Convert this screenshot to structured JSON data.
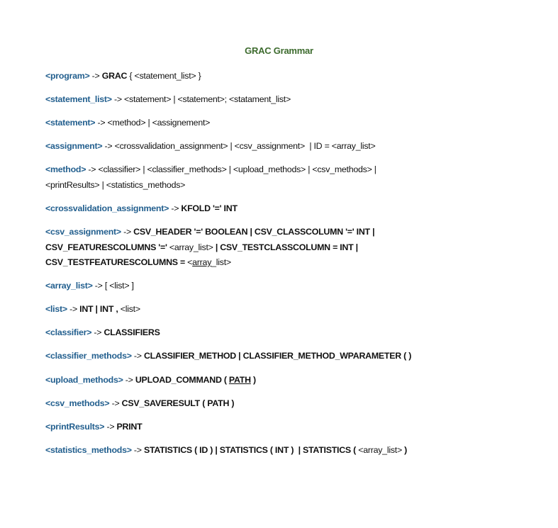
{
  "title": "GRAC Grammar",
  "colors": {
    "title": "#3d6b2e",
    "nonterminal": "#24608f",
    "text": "#111111"
  },
  "rules": [
    {
      "lhs": "<program>",
      "rhs": [
        {
          "t": " -> ",
          "s": "normal"
        },
        {
          "t": "GRAC",
          "s": "bold"
        },
        {
          "t": " { <statement_list> }",
          "s": "normal"
        }
      ]
    },
    {
      "lhs": "<statement_list>",
      "rhs": [
        {
          "t": " -> <statement> | <statement>; <statament_list>",
          "s": "normal"
        }
      ]
    },
    {
      "lhs": "<statement>",
      "rhs": [
        {
          "t": " -> <method> | <assignement>",
          "s": "normal"
        }
      ]
    },
    {
      "lhs": "<assignment>",
      "rhs": [
        {
          "t": " -> <crossvalidation_assignment> | <csv_assignment>  | ID = <array_list>",
          "s": "normal"
        }
      ]
    },
    {
      "lhs": "<method>",
      "rhs": [
        {
          "t": " -> <classifier> | <classifier_methods> | <upload_methods> | <csv_methods> |\n<printResults> | <statistics_methods>",
          "s": "normal"
        }
      ]
    },
    {
      "lhs": "<crossvalidation_assignment>",
      "rhs": [
        {
          "t": " -> ",
          "s": "normal"
        },
        {
          "t": "KFOLD '=' INT",
          "s": "bold"
        }
      ]
    },
    {
      "lhs": "<csv_assignment>",
      "rhs": [
        {
          "t": " -> ",
          "s": "normal"
        },
        {
          "t": "CSV_HEADER '=' BOOLEAN | CSV_CLASSCOLUMN '=' INT |\nCSV_FEATURESCOLUMNS '='",
          "s": "bold"
        },
        {
          "t": " <array_list> ",
          "s": "normal"
        },
        {
          "t": "| CSV_TESTCLASSCOLUMN = INT |\nCSV_TESTFEATURESCOLUMNS = ",
          "s": "bold"
        },
        {
          "t": "<",
          "s": "normal"
        },
        {
          "t": "array",
          "s": "underline"
        },
        {
          "t": "_list>",
          "s": "normal"
        }
      ]
    },
    {
      "lhs": "<array_list>",
      "rhs": [
        {
          "t": " -> [ <list> ]",
          "s": "normal"
        }
      ]
    },
    {
      "lhs": "<list>",
      "rhs": [
        {
          "t": " -> ",
          "s": "normal"
        },
        {
          "t": "INT | INT ,",
          "s": "bold"
        },
        {
          "t": " <list>",
          "s": "normal"
        }
      ]
    },
    {
      "lhs": "<classifier>",
      "rhs": [
        {
          "t": " -> ",
          "s": "normal"
        },
        {
          "t": "CLASSIFIERS",
          "s": "bold"
        }
      ]
    },
    {
      "lhs": "<classifier_methods>",
      "rhs": [
        {
          "t": " -> ",
          "s": "normal"
        },
        {
          "t": "CLASSIFIER_METHOD | CLASSIFIER_METHOD_WPARAMETER ( )",
          "s": "bold"
        }
      ]
    },
    {
      "lhs": "<upload_methods>",
      "rhs": [
        {
          "t": " -> ",
          "s": "normal"
        },
        {
          "t": "UPLOAD_COMMAND ( ",
          "s": "bold"
        },
        {
          "t": "PATH",
          "s": "bold-underline"
        },
        {
          "t": " )",
          "s": "bold"
        }
      ]
    },
    {
      "lhs": "<csv_methods>",
      "rhs": [
        {
          "t": " -> ",
          "s": "normal"
        },
        {
          "t": "CSV_SAVERESULT ( PATH )",
          "s": "bold"
        }
      ]
    },
    {
      "lhs": "<printResults>",
      "rhs": [
        {
          "t": " -> ",
          "s": "normal"
        },
        {
          "t": "PRINT",
          "s": "bold"
        }
      ]
    },
    {
      "lhs": "<statistics_methods>",
      "rhs": [
        {
          "t": " -> ",
          "s": "normal"
        },
        {
          "t": "STATISTICS ( ID ) | STATISTICS ( INT )  | STATISTICS ( ",
          "s": "bold"
        },
        {
          "t": "<array_list>",
          "s": "normal"
        },
        {
          "t": " )",
          "s": "bold"
        }
      ]
    }
  ]
}
